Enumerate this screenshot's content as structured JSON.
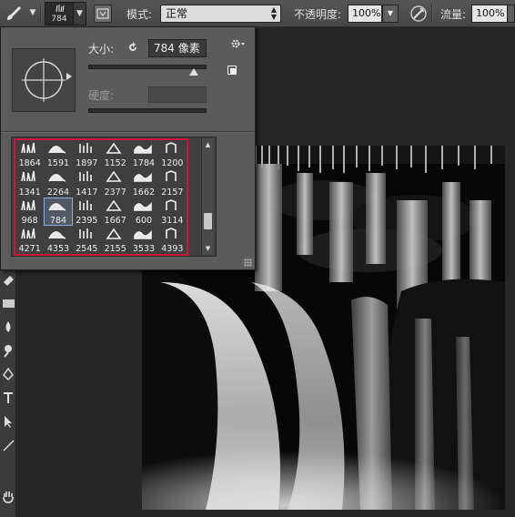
{
  "options_bar": {
    "brush_tool_icon": "brush-icon",
    "brush_preset_size": "784",
    "mode_label": "模式:",
    "mode_value": "正常",
    "opacity_label": "不透明度:",
    "opacity_value": "100%",
    "flow_label": "流量:",
    "flow_value": "100%"
  },
  "brush_panel": {
    "size_label": "大小:",
    "size_value": "784 像素",
    "size_slider_fraction": 0.93,
    "hardness_label": "硬度:",
    "hardness_value": "",
    "brushes": [
      {
        "num": "1864"
      },
      {
        "num": "1591"
      },
      {
        "num": "1897"
      },
      {
        "num": "1152"
      },
      {
        "num": "1784"
      },
      {
        "num": "1200"
      },
      {
        "num": "1341"
      },
      {
        "num": "2264"
      },
      {
        "num": "1417"
      },
      {
        "num": "2377"
      },
      {
        "num": "1662"
      },
      {
        "num": "2157"
      },
      {
        "num": "968"
      },
      {
        "num": "784",
        "selected": true
      },
      {
        "num": "2395"
      },
      {
        "num": "1667"
      },
      {
        "num": "600"
      },
      {
        "num": "3114"
      },
      {
        "num": "4271"
      },
      {
        "num": "4353"
      },
      {
        "num": "2545"
      },
      {
        "num": "2155"
      },
      {
        "num": "3533"
      },
      {
        "num": "4393"
      }
    ]
  },
  "colors": {
    "highlight_border": "#d0153c",
    "panel_bg": "#5b5b5b",
    "workspace_bg": "#262626"
  },
  "toolbox": [
    "eraser-icon",
    "gradient-icon",
    "blur-icon",
    "dodge-icon",
    "pen-icon",
    "type-icon",
    "path-selection-icon",
    "line-icon",
    "hand-icon"
  ]
}
